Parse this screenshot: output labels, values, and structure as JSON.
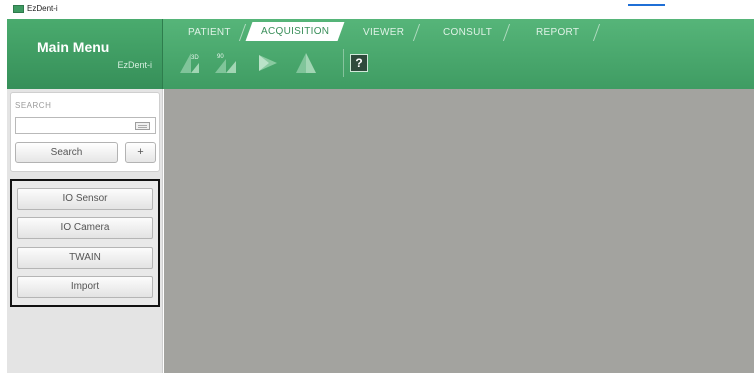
{
  "window": {
    "title": "EzDent-i"
  },
  "main_menu": {
    "title": "Main Menu",
    "subtitle": "EzDent-i"
  },
  "tabs": [
    {
      "label": "PATIENT",
      "active": false
    },
    {
      "label": "ACQUISITION",
      "active": true
    },
    {
      "label": "VIEWER",
      "active": false
    },
    {
      "label": "CONSULT",
      "active": false
    },
    {
      "label": "REPORT",
      "active": false
    }
  ],
  "toolbar": {
    "tools": [
      "acquisition-3d-icon",
      "acquisition-90-icon",
      "acquisition-angle-icon",
      "acquisition-flat-icon"
    ],
    "help_label": "?"
  },
  "search": {
    "label": "SEARCH",
    "value": "",
    "placeholder": "",
    "button_label": "Search",
    "plus_label": "+"
  },
  "sources": [
    {
      "label": "IO Sensor"
    },
    {
      "label": "IO Camera"
    },
    {
      "label": "TWAIN"
    },
    {
      "label": "Import"
    }
  ],
  "colors": {
    "header_green": "#4aab6e",
    "workspace_gray": "#a3a39f",
    "sidebar_gray": "#e4e4e4"
  }
}
